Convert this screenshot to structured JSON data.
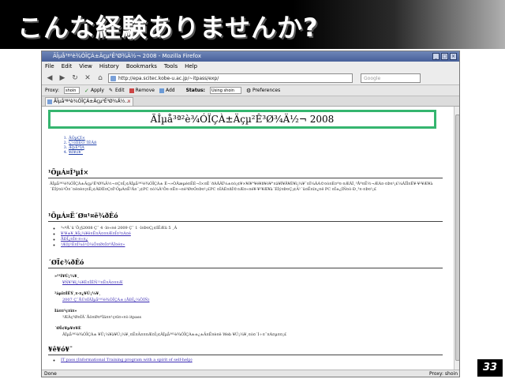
{
  "slide": {
    "title": "こんな経験ありませんか?",
    "page_number": "33"
  },
  "browser": {
    "window_title": "ÃÎµå³ª²è¾ÓÏÇÀ±Äçµ²Ê³Ø¾Ä½¬ 2008 - Mozilla Firefox",
    "menu": [
      "File",
      "Edit",
      "View",
      "History",
      "Bookmarks",
      "Tools",
      "Help"
    ],
    "url": "http://epa.scitec.kobe-u.ac.jp/~itpass/exp/",
    "search_placeholder": "Google",
    "proxybar": {
      "proxy_label": "Proxy:",
      "proxy_value": "shoin",
      "apply": "Apply",
      "edit": "Edit",
      "remove": "Remove",
      "add": "Add",
      "status_label": "Status:",
      "status_value": "Using shoin",
      "preferences": "Preferences"
    },
    "tab_title": "ÃÎµå³ª²è¾ÓÏÇÀ±Äçµ²Ê³Ø¾Ä½...",
    "status_left": "Done",
    "status_right": "Proxy: shoin"
  },
  "page": {
    "banner": "ÃÎµå³ª²è¾ÓÏÇÀ±Äçµ²Ê³Ø¾Ä½¬ 2008",
    "toc": [
      "ÃÕµÇÍ×",
      "Ç½ÎÏÈÒ¨ÎÊÃß",
      "ÆþÊªÎÁ",
      "¥ê¥ó¥¯"
    ],
    "sec1_title": "¹ÕµÁ¤Î³µÍ×",
    "sec1_text": "ÃÎµå³ª²è¾ÓÏÇÀ±Äçµ²Ê³Ø¾Ä½¬¤Ç¤Ï¡¢ÃÎµå³ª²è¾ÓÏÇÀ± Ê¬»ÒÃæµé¤ËÉ¬Í×¤Ê´ðÁÃÃÎ¼±¤ò¡¢¥×¥í¥°¥é¥ß¥ó¥°¤ä¥Í¥Ã¥È¥ï¡¼¥¯¤Î¼ÂÁ©¤ò¤È¤ª¤·¤ÆÂÎ¸³Åª¤Ë½¬ÆÀ¤·¤Þ¤¹¡£¼ÂÎÏ¤Ê¥·¥¹¥Æ¥à´ÉÍý¤ò¹Ô¤¨¤ë¤è¤¦¤Ë¡¢ÂÐÌÌ¤Ç¤Î¹ÕµÁ¤Ë²Ã¤¨¡¢PC ¤ò¼Â¹Ô¤·¤Ê¤¬¤é³Ø¤Ó¤Þ¤¹¡£PC ¤ÎÁÈ¤ßÎ©¤Æ¤«¤é¥·¥¹¥Æ¥à´ÉÍý¤Þ¤Ç¡¢Ä¹´ü¤Ë¤ï¤¿¤ë PC ¤Î±¿ÍÑ¤ò·Ð¸³¤·¤Þ¤¹¡£",
    "sec2_title": "¹ÕµÁ¤Ë´Ø¤¹¤ë¾ðÊó",
    "sec2_items": [
      "³«ºÅ´ü´Ö¡§2008 Ç¯ 4 ·î¤«¤é 2009 Ç¯ 1 ·î¤Þ¤Ç¡¢ÍËÆü 5 ¸Â",
      "¥¹¥±¥¸¥å¡¼¥ë¤Ë¤Ä¤¤¤Æ¤Ï¤³¤Á¤é",
      "ÅÐÏ¿¤Î¤·¤«¤¿",
      "³ÆÍý²Ê¤Î¼õ¹Ö¼Ô¤Ø¤Î¤ªÃÎ¤é¤»"
    ],
    "sec3_title": "´ØÏ¢¾ðÊó",
    "sec3_groups": [
      {
        "heading": "»²¹Í¥Ú¡¼¥¸",
        "item": "¥Ñ¥¹¥ï¡¼¥É¤ÎÊÑ¹¹¤Ë¤Ä¤¤¤Æ"
      },
      {
        "heading": "²áµî¤ÎÊÝ¸¤·¤¿¥Ú¡¼¥¸",
        "item": "2007 Ç¯ÅÙ¤ÎÃÎµå³ª²è¾ÓÏÇÀ± (ÅÐÏ¿¼ÔÍÑ)"
      },
      {
        "heading": "Ìä¤¤¹ç¤ï¤»",
        "item": "³ÆÂç³Ø¤ÎÃ´Åö¤Ø¤ªÌä¤¤¹ç¤ï¤»¤ò itpass"
      },
      {
        "heading": "´ØÏ¢¥µ¥¤¥È",
        "item": "ÃÎµå³ª²è¾ÓÏÇÀ± ¥Û¡¼¥à¥Ú¡¼¥¸¤Ë¤Ä¤¤¤Æ¤Ï¡¢ÃÎµå³ª²è¾ÓÏÇÀ±±¿±Ä¤Ë¤è¤ë Web ¥Ú¡¼¥¸¤ò¤´Í÷¤¯¤À¤µ¤¤¡£"
      }
    ],
    "sec4_title": "¥ê¥ó¥¯",
    "sec4_items": [
      "IT pass (Informational Training program with a spirit of self-help)"
    ]
  }
}
